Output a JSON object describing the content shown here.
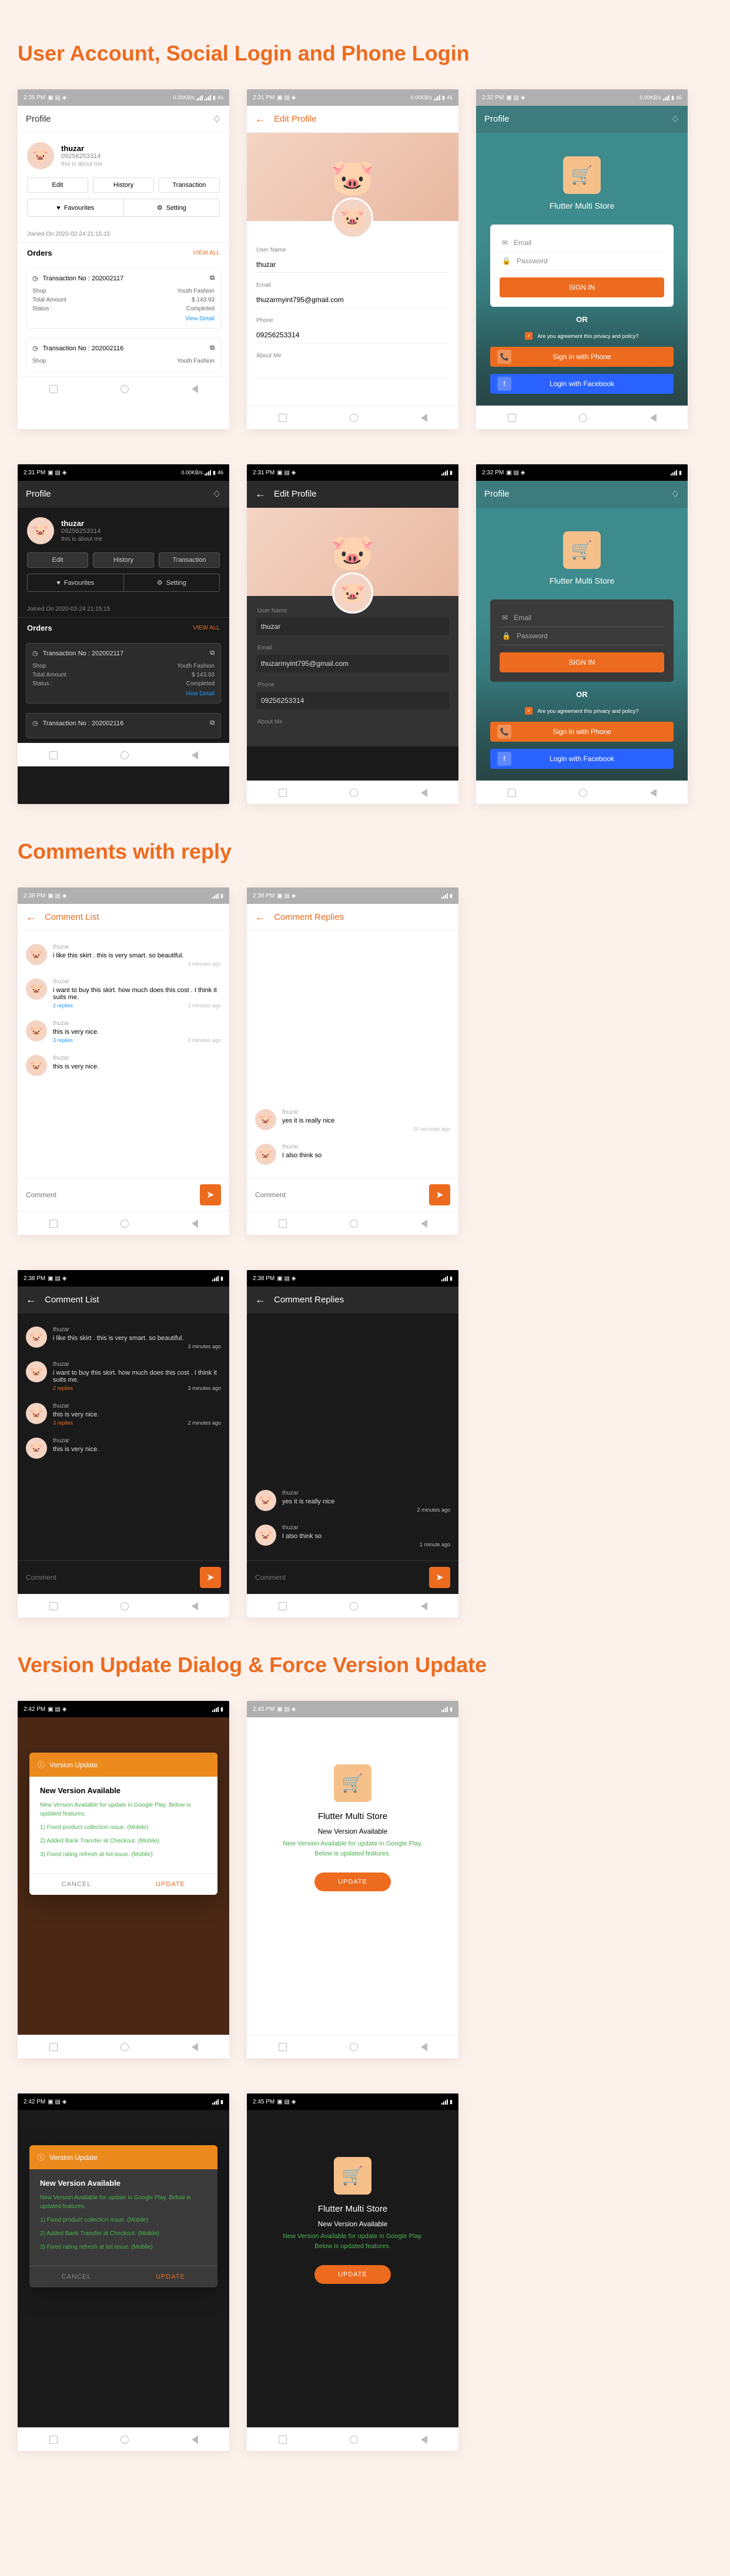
{
  "sections": {
    "s1": "User Account,  Social Login and Phone Login",
    "s2": "Comments with reply",
    "s3": "Version Update Dialog & Force Version Update"
  },
  "status": {
    "time": "2:35 PM",
    "time2": "2:31 PM",
    "time3": "2:32 PM",
    "time4": "2:38 PM",
    "time5": "2:42 PM",
    "time6": "2:45 PM",
    "net": "0.00KB/s",
    "batt": "46"
  },
  "profile": {
    "title": "Profile",
    "name": "thuzar",
    "phone": "09256253314",
    "bio": "this is about me",
    "tabs": [
      "Edit",
      "History",
      "Transaction"
    ],
    "fav": "Favourites",
    "set": "Setting",
    "joined": "Joined On 2020-02-24 21:15:15",
    "orders": "Orders",
    "viewall": "VIEW ALL",
    "txn1": {
      "no": "Transaction No : 202002117",
      "shop": "Shop",
      "shopv": "Youth Fashion",
      "total": "Total Amount",
      "totalv": "$ 143.93",
      "status": "Status :",
      "statusv": "Completed",
      "vd": "View Detail"
    },
    "txn2": {
      "no": "Transaction No : 202002116",
      "shop": "Shop",
      "shopv": "Youth Fashion"
    }
  },
  "edit": {
    "title": "Edit Profile",
    "un": "User Name",
    "unv": "thuzar",
    "em": "Email",
    "emv": "thuzarmyint795@gmail.com",
    "ph": "Phone",
    "phv": "09256253314",
    "ab": "About Me"
  },
  "login": {
    "brand": "Flutter Multi Store",
    "email": "Email",
    "pass": "Password",
    "signin": "SIGN IN",
    "or": "OR",
    "agree": "Are you agreement this privacy and policy?",
    "phone": "Sign in with Phone",
    "fb": "Login with Facebook"
  },
  "comments": {
    "list": "Comment List",
    "replies": "Comment Replies",
    "u": "thuzar",
    "c1": "i like this skirt . this is very smart. so beautiful.",
    "c2": "i want to buy this skirt. how much does this cost . I think it suits me.",
    "c3": "this is very nice.",
    "c4": "this is very nice.",
    "r1": "yes it is really nice",
    "r2": "I also think so",
    "reply2": "2 replies",
    "reply3": "3 replies",
    "mins2": "2 minutes ago",
    "mins3": "3 minutes ago",
    "secs": "20 seconds ago",
    "min1": "1 minute ago",
    "ph": "Comment"
  },
  "dialog": {
    "hdr": "Version Update",
    "title": "New Version Available",
    "desc": "New Version Available for update in Google Play. Below is updated features.",
    "f1": "1) Fixed product collection issue. (Mobile)",
    "f2": "2) Added Bank Transfer at Checkout. (Mobile)",
    "f3": "3) Fixed rating refresh at list issue. (Mobile)",
    "cancel": "CANCEL",
    "update": "UPDATE"
  }
}
